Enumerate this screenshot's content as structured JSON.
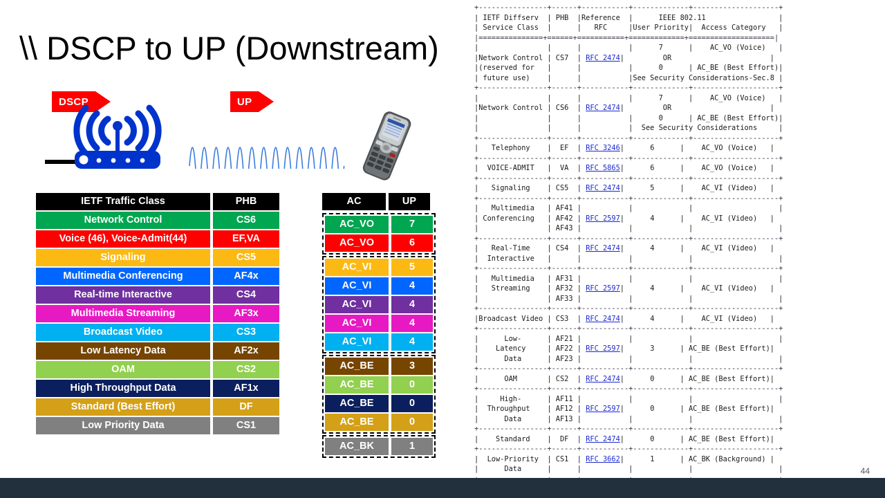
{
  "slide": {
    "title": "\\\\ DSCP to UP (Downstream)",
    "page_number": "44",
    "bottom_bar_color": "#222f3d"
  },
  "diagram": {
    "dscp_arrow_label": "DSCP",
    "up_arrow_label": "UP",
    "access_point_icon": "wifi-router-icon",
    "cable_icon": "ethernet-cable-icon",
    "wireless_signal_icon": "sine-wave-icon",
    "phone_icon": "wireless-ip-phone-icon",
    "arrow_color": "#fe0000",
    "router_color": "#0033cc",
    "wave_color": "#3b7ddd"
  },
  "left_table": {
    "headers": [
      "IETF Traffic Class",
      "PHB"
    ],
    "rows": [
      {
        "traffic_class": "Network Control",
        "phb": "CS6",
        "color": "#00a650"
      },
      {
        "traffic_class": "Voice (46), Voice-Admit(44)",
        "phb": "EF,VA",
        "color": "#fe0000"
      },
      {
        "traffic_class": "Signaling",
        "phb": "CS5",
        "color": "#fdb913"
      },
      {
        "traffic_class": "Multimedia Conferencing",
        "phb": "AF4x",
        "color": "#0066ff"
      },
      {
        "traffic_class": "Real-time Interactive",
        "phb": "CS4",
        "color": "#7030a0"
      },
      {
        "traffic_class": "Multimedia Streaming",
        "phb": "AF3x",
        "color": "#e719c3"
      },
      {
        "traffic_class": "Broadcast Video",
        "phb": "CS3",
        "color": "#00b0f0"
      },
      {
        "traffic_class": "Low Latency Data",
        "phb": "AF2x",
        "color": "#764500"
      },
      {
        "traffic_class": "OAM",
        "phb": "CS2",
        "color": "#92d050"
      },
      {
        "traffic_class": "High Throughput Data",
        "phb": "AF1x",
        "color": "#0b1f5e"
      },
      {
        "traffic_class": "Standard (Best Effort)",
        "phb": "DF",
        "color": "#d4a017"
      },
      {
        "traffic_class": "Low Priority Data",
        "phb": "CS1",
        "color": "#808080"
      }
    ]
  },
  "ac_table": {
    "headers": [
      "AC",
      "UP"
    ],
    "groups": [
      {
        "name": "voice-group",
        "rows": [
          {
            "ac": "AC_VO",
            "up": "7",
            "color": "#00a650"
          },
          {
            "ac": "AC_VO",
            "up": "6",
            "color": "#fe0000"
          }
        ]
      },
      {
        "name": "video-group",
        "rows": [
          {
            "ac": "AC_VI",
            "up": "5",
            "color": "#fdb913"
          },
          {
            "ac": "AC_VI",
            "up": "4",
            "color": "#0066ff"
          },
          {
            "ac": "AC_VI",
            "up": "4",
            "color": "#7030a0"
          },
          {
            "ac": "AC_VI",
            "up": "4",
            "color": "#e719c3"
          },
          {
            "ac": "AC_VI",
            "up": "4",
            "color": "#00b0f0"
          }
        ]
      },
      {
        "name": "best-effort-group",
        "rows": [
          {
            "ac": "AC_BE",
            "up": "3",
            "color": "#764500"
          },
          {
            "ac": "AC_BE",
            "up": "0",
            "color": "#92d050"
          },
          {
            "ac": "AC_BE",
            "up": "0",
            "color": "#0b1f5e"
          },
          {
            "ac": "AC_BE",
            "up": "0",
            "color": "#d4a017"
          }
        ]
      },
      {
        "name": "background-group",
        "rows": [
          {
            "ac": "AC_BK",
            "up": "1",
            "color": "#808080"
          }
        ]
      }
    ]
  },
  "rfc_table": {
    "headers": {
      "col1": "IETF Diffserv Service Class",
      "col2": "PHB",
      "col3": "Reference RFC",
      "col4_group": "IEEE 802.11",
      "col4": "User Priority",
      "col5": "Access Category"
    },
    "rows": [
      {
        "service_class": "Network Control (reserved for future use)",
        "phb": "CS7",
        "rfc": "RFC 2474",
        "user_priority": "7 OR 0",
        "access_category": "AC_VO (Voice) / AC_BE (Best Effort)",
        "note": "See Security Considerations-Sec.8"
      },
      {
        "service_class": "Network Control",
        "phb": "CS6",
        "rfc": "RFC 2474",
        "user_priority": "7 OR 0",
        "access_category": "AC_VO (Voice) / AC_BE (Best Effort)",
        "note": "See Security Considerations"
      },
      {
        "service_class": "Telephony",
        "phb": "EF",
        "rfc": "RFC 3246",
        "user_priority": "6",
        "access_category": "AC_VO (Voice)",
        "note": ""
      },
      {
        "service_class": "VOICE-ADMIT",
        "phb": "VA",
        "rfc": "RFC 5865",
        "user_priority": "6",
        "access_category": "AC_VO (Voice)",
        "note": ""
      },
      {
        "service_class": "Signaling",
        "phb": "CS5",
        "rfc": "RFC 2474",
        "user_priority": "5",
        "access_category": "AC_VI (Video)",
        "note": ""
      },
      {
        "service_class": "Multimedia Conferencing",
        "phb": "AF41 AF42 AF43",
        "rfc": "RFC 2597",
        "user_priority": "4",
        "access_category": "AC_VI (Video)",
        "note": ""
      },
      {
        "service_class": "Real-Time Interactive",
        "phb": "CS4",
        "rfc": "RFC 2474",
        "user_priority": "4",
        "access_category": "AC_VI (Video)",
        "note": ""
      },
      {
        "service_class": "Multimedia Streaming",
        "phb": "AF31 AF32 AF33",
        "rfc": "RFC 2597",
        "user_priority": "4",
        "access_category": "AC_VI (Video)",
        "note": ""
      },
      {
        "service_class": "Broadcast Video",
        "phb": "CS3",
        "rfc": "RFC 2474",
        "user_priority": "4",
        "access_category": "AC_VI (Video)",
        "note": ""
      },
      {
        "service_class": "Low-Latency Data",
        "phb": "AF21 AF22 AF23",
        "rfc": "RFC 2597",
        "user_priority": "3",
        "access_category": "AC_BE (Best Effort)",
        "note": ""
      },
      {
        "service_class": "OAM",
        "phb": "CS2",
        "rfc": "RFC 2474",
        "user_priority": "0",
        "access_category": "AC_BE (Best Effort)",
        "note": ""
      },
      {
        "service_class": "High-Throughput Data",
        "phb": "AF11 AF12 AF13",
        "rfc": "RFC 2597",
        "user_priority": "0",
        "access_category": "AC_BE (Best Effort)",
        "note": ""
      },
      {
        "service_class": "Standard",
        "phb": "DF",
        "rfc": "RFC 2474",
        "user_priority": "0",
        "access_category": "AC_BE (Best Effort)",
        "note": ""
      },
      {
        "service_class": "Low-Priority Data",
        "phb": "CS1",
        "rfc": "RFC 3662",
        "user_priority": "1",
        "access_category": "AC_BK (Background)",
        "note": ""
      }
    ],
    "ascii_lines": [
      "+----------------+------+-----------+-------------+--------------------+",
      "| IETF Diffserv  | PHB  |Reference  |      IEEE 802.11                 |",
      "| Service Class  |      |   RFC     |User Priority|  Access Category   |",
      "|===============+======+===========+=============+====================|",
      "|                |      |           |      7      |    AC_VO (Voice)   |",
      "|Network Control | CS7  | @RFC 2474@|         OR                       |",
      "|(reserved for   |      |           |      0      | AC_BE (Best Effort)|",
      "| future use)    |      |           |See Security Considerations-Sec.8 |",
      "+----------------+------+-----------+-------------+--------------------+",
      "|                |      |           |      7      |    AC_VO (Voice)   |",
      "|Network Control | CS6  | @RFC 2474@|         OR                       |",
      "|                |      |           |      0      | AC_BE (Best Effort)|",
      "|                |      |           |  See Security Considerations     |",
      "+----------------+------+-----------+-------------+--------------------+",
      "|   Telephony    |  EF  | @RFC 3246@|      6      |    AC_VO (Voice)   |",
      "+----------------+------+-----------+-------------+--------------------+",
      "|  VOICE-ADMIT   |  VA  | @RFC 5865@|      6      |    AC_VO (Voice)   |",
      "+----------------+------+-----------+-------------+--------------------+",
      "|   Signaling    | CS5  | @RFC 2474@|      5      |    AC_VI (Video)   |",
      "+----------------+------+-----------+-------------+--------------------+",
      "|   Multimedia   | AF41 |           |             |                    |",
      "| Conferencing   | AF42 | @RFC 2597@|      4      |    AC_VI (Video)   |",
      "|                | AF43 |           |             |                    |",
      "+----------------+------+-----------+-------------+--------------------+",
      "|   Real-Time    | CS4  | @RFC 2474@|      4      |    AC_VI (Video)   |",
      "|  Interactive   |      |           |             |                    |",
      "+----------------+------+-----------+-------------+--------------------+",
      "|   Multimedia   | AF31 |           |             |                    |",
      "|   Streaming    | AF32 | @RFC 2597@|      4      |    AC_VI (Video)   |",
      "|                | AF33 |           |             |                    |",
      "+----------------+------+-----------+-------------+--------------------+",
      "|Broadcast Video | CS3  | @RFC 2474@|      4      |    AC_VI (Video)   |",
      "+----------------+------+-----------+-------------+--------------------+",
      "|      Low-      | AF21 |           |             |                    |",
      "|    Latency     | AF22 | @RFC 2597@|      3      | AC_BE (Best Effort)|",
      "|      Data      | AF23 |           |             |                    |",
      "+----------------+------+-----------+-------------+--------------------+",
      "|      OAM       | CS2  | @RFC 2474@|      0      | AC_BE (Best Effort)|",
      "+----------------+------+-----------+-------------+--------------------+",
      "|     High-      | AF11 |           |             |                    |",
      "|  Throughput    | AF12 | @RFC 2597@|      0      | AC_BE (Best Effort)|",
      "|      Data      | AF13 |           |             |                    |",
      "+----------------+------+-----------+-------------+--------------------+",
      "|    Standard    |  DF  | @RFC 2474@|      0      | AC_BE (Best Effort)|",
      "+----------------+------+-----------+-------------+--------------------+",
      "|  Low-Priority  | CS1  | @RFC 3662@|      1      | AC_BK (Background) |",
      "|      Data      |      |           |             |                    |",
      "+----------------+------+-----------+-------------+--------------------+"
    ]
  }
}
